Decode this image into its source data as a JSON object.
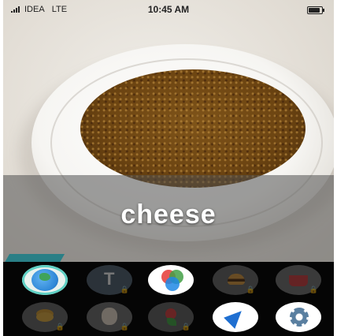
{
  "status_bar": {
    "carrier": "IDEA",
    "network": "LTE",
    "time": "10:45 AM"
  },
  "camera": {
    "detected_label": "cheese"
  },
  "tray": {
    "rows": [
      [
        {
          "icon": "globe-icon",
          "locked": false
        },
        {
          "icon": "text-icon",
          "glyph": "T",
          "locked": true
        },
        {
          "icon": "color-circles-icon",
          "locked": false
        },
        {
          "icon": "burger-icon",
          "locked": true
        },
        {
          "icon": "basket-icon",
          "locked": true
        }
      ],
      [
        {
          "icon": "coins-icon",
          "locked": true
        },
        {
          "icon": "dog-icon",
          "locked": true
        },
        {
          "icon": "flower-icon",
          "locked": true
        },
        {
          "icon": "navigation-arrow-icon",
          "locked": false
        },
        {
          "icon": "settings-gear-icon",
          "locked": false
        }
      ]
    ],
    "lock_glyph": "🔒"
  },
  "colors": {
    "tray_background": "#050505",
    "active_ring": "#5fd0c4",
    "nav_arrow": "#1f6fd1"
  }
}
